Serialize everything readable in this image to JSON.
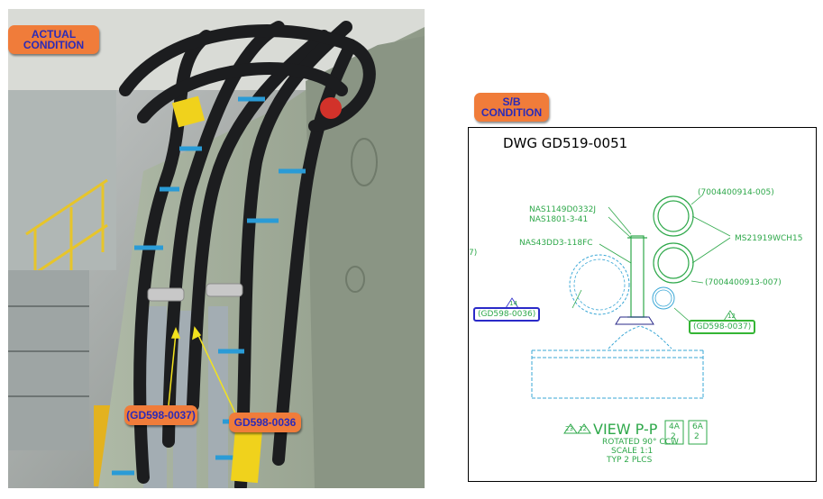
{
  "callouts": {
    "actual": "ACTUAL\nCONDITION",
    "sb": "S/B\nCONDITION",
    "gd37_photo": "(GD598-0037)",
    "gd36_photo": "GD598-0036"
  },
  "drawing": {
    "title": "DWG GD519-0051",
    "labels": {
      "p1": "(7004400914-005)",
      "p2": "(7004400913-007)",
      "ms": "MS21919WCH15",
      "nas1149": "NAS1149D0332J",
      "nas1801": "NAS1801-3-41",
      "nas43": "NAS43DD3-118FC",
      "seven": "7)",
      "gd36": "(GD598-0036)",
      "gd37": "(GD598-0037)",
      "tri14": "14",
      "tri12": "12",
      "view": "VIEW P-P",
      "rotated": "ROTATED 90° CCW",
      "scale": "SCALE 1:1",
      "typ": "TYP 2 PLCS",
      "ref1_top": "4A",
      "ref1_bot": "2",
      "ref2_top": "6A",
      "ref2_bot": "2",
      "view_tri1": "23",
      "view_tri2": "12"
    }
  },
  "colors": {
    "callout_orange": "#f07c3a",
    "callout_text": "#2b2bb8",
    "drawing_green": "#2ea84a",
    "drawing_blue": "#3aa7d6",
    "highlight_blue": "#2a2ac8",
    "highlight_green": "#35b535"
  }
}
